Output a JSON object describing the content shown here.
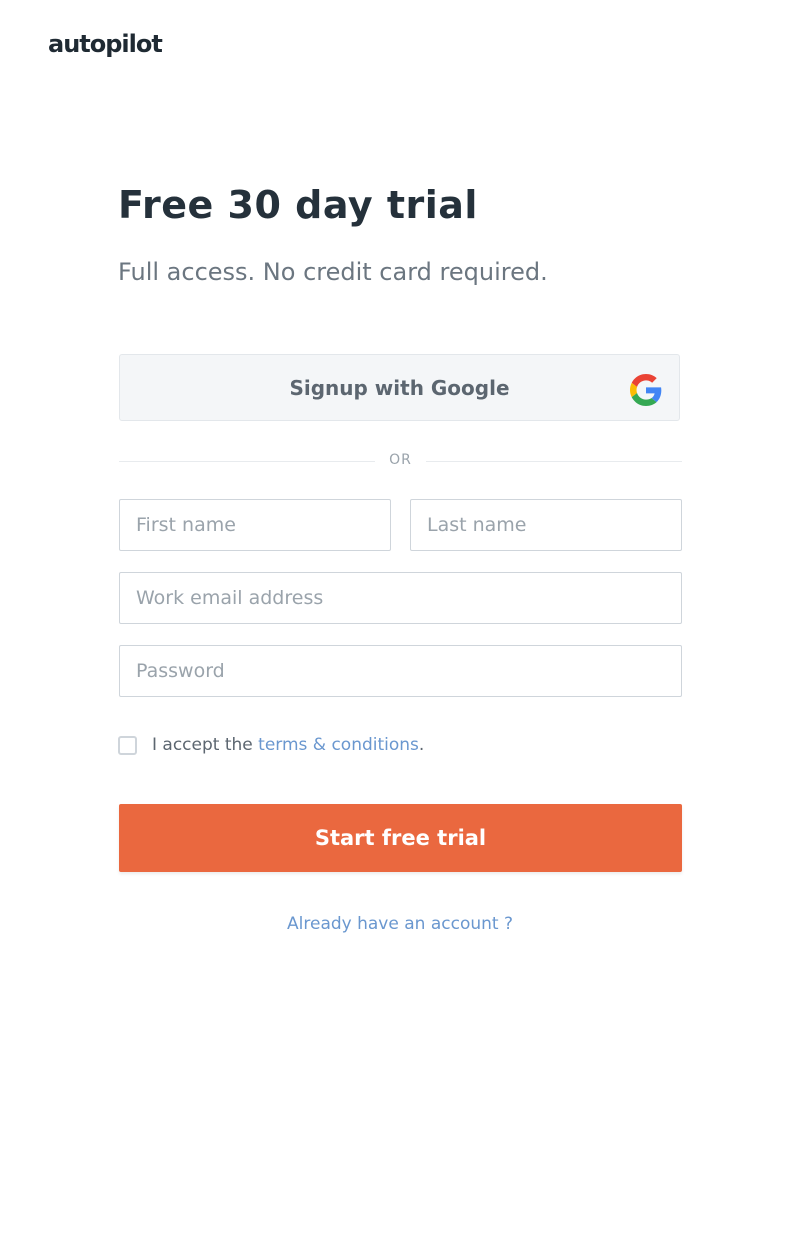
{
  "brand": {
    "logo_text": "autopilot"
  },
  "hero": {
    "title": "Free 30 day trial",
    "subtitle": "Full access. No credit card required."
  },
  "google_signup": {
    "label": "Signup with Google",
    "icon": "google-g-icon"
  },
  "divider": {
    "label": "OR"
  },
  "form": {
    "first_name": {
      "placeholder": "First name",
      "value": ""
    },
    "last_name": {
      "placeholder": "Last name",
      "value": ""
    },
    "email": {
      "placeholder": "Work email address",
      "value": ""
    },
    "password": {
      "placeholder": "Password",
      "value": ""
    },
    "terms": {
      "prefix": "I accept the",
      "link_label": "terms & conditions",
      "suffix": ".",
      "checked": false
    },
    "submit_label": "Start free trial"
  },
  "footer": {
    "login_link": "Already have an account ?"
  },
  "colors": {
    "primary_button": "#ea683f",
    "link": "#6a97cf",
    "google_button_bg": "#f4f6f8"
  }
}
